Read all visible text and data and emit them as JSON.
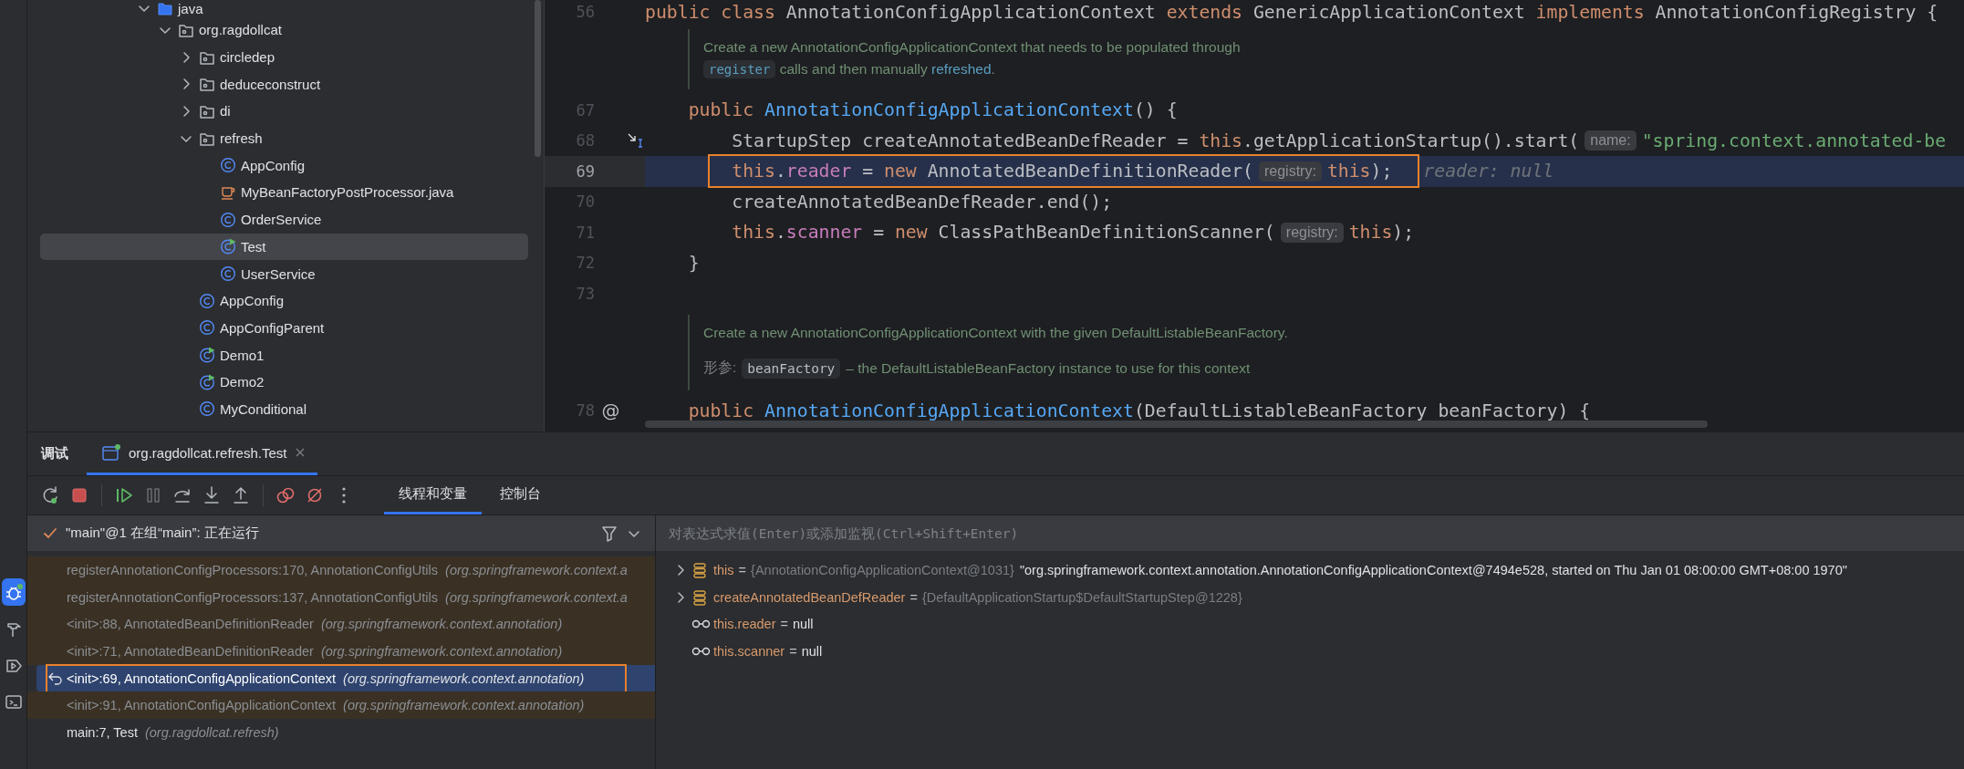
{
  "tool_strip": [
    {
      "kind": "debug",
      "selected": true
    },
    {
      "kind": "build",
      "selected": false
    },
    {
      "kind": "run",
      "selected": false
    },
    {
      "kind": "terminal",
      "selected": false
    }
  ],
  "project_tree": [
    {
      "label": "java",
      "kind": "source-root",
      "expanded": true,
      "selected": false,
      "children": [
        {
          "label": "org.ragdollcat",
          "kind": "package",
          "expanded": true,
          "selected": false,
          "children": [
            {
              "label": "circledep",
              "kind": "package",
              "expanded": false,
              "selected": false
            },
            {
              "label": "deduceconstruct",
              "kind": "package",
              "expanded": false,
              "selected": false
            },
            {
              "label": "di",
              "kind": "package",
              "expanded": false,
              "selected": false
            },
            {
              "label": "refresh",
              "kind": "package",
              "expanded": true,
              "selected": false,
              "children": [
                {
                  "label": "AppConfig",
                  "kind": "class",
                  "selected": false
                },
                {
                  "label": "MyBeanFactoryPostProcessor.java",
                  "kind": "java-file",
                  "selected": false
                },
                {
                  "label": "OrderService",
                  "kind": "class",
                  "selected": false
                },
                {
                  "label": "Test",
                  "kind": "main-class",
                  "selected": true
                },
                {
                  "label": "UserService",
                  "kind": "class",
                  "selected": false
                }
              ]
            },
            {
              "label": "AppConfig",
              "kind": "class",
              "selected": false
            },
            {
              "label": "AppConfigParent",
              "kind": "class",
              "selected": false
            },
            {
              "label": "Demo1",
              "kind": "main-class",
              "selected": false
            },
            {
              "label": "Demo2",
              "kind": "main-class",
              "selected": false
            },
            {
              "label": "MyConditional",
              "kind": "class",
              "selected": false
            }
          ]
        }
      ]
    }
  ],
  "editor": {
    "lines": [
      {
        "kind": "code",
        "number": "56",
        "current": false,
        "tokens": [
          {
            "text": "public class ",
            "kind": "keyword"
          },
          {
            "text": "AnnotationConfigApplicationContext ",
            "kind": "plain"
          },
          {
            "text": "extends ",
            "kind": "keyword"
          },
          {
            "text": "GenericApplicationContext ",
            "kind": "plain"
          },
          {
            "text": "implements ",
            "kind": "keyword"
          },
          {
            "text": "AnnotationConfigRegistry {",
            "kind": "plain"
          }
        ]
      },
      {
        "kind": "doc",
        "paragraphs": [
          {
            "kind": "text",
            "segments": [
              {
                "kind": "text",
                "text": "Create a new AnnotationConfigApplicationContext that needs to be populated through "
              },
              {
                "kind": "code",
                "text": "register"
              },
              {
                "kind": "text",
                "text": " calls and then manually "
              },
              {
                "kind": "link",
                "text": "refreshed"
              },
              {
                "kind": "text",
                "text": "."
              }
            ]
          }
        ]
      },
      {
        "kind": "code",
        "number": "67",
        "current": false,
        "tokens": [
          {
            "text": "    public ",
            "kind": "keyword"
          },
          {
            "text": "AnnotationConfigApplicationContext",
            "kind": "method"
          },
          {
            "text": "() {",
            "kind": "plain"
          }
        ]
      },
      {
        "kind": "code",
        "number": "68",
        "current": false,
        "execution_point": true,
        "tokens": [
          {
            "text": "        StartupStep createAnnotatedBeanDefReader = ",
            "kind": "plain"
          },
          {
            "text": "this",
            "kind": "keyword"
          },
          {
            "text": ".getApplicationStartup().start(",
            "kind": "plain"
          },
          {
            "text": "name:",
            "kind": "hint"
          },
          {
            "text": "\"spring.context.annotated-be",
            "kind": "string"
          }
        ]
      },
      {
        "kind": "code",
        "number": "69",
        "current": true,
        "tokens": [
          {
            "kind": "group",
            "boxed": true,
            "tokens": [
              {
                "text": "        this",
                "kind": "keyword"
              },
              {
                "text": ".",
                "kind": "plain"
              },
              {
                "text": "reader",
                "kind": "field"
              },
              {
                "text": " = ",
                "kind": "plain"
              },
              {
                "text": "new ",
                "kind": "keyword"
              },
              {
                "text": "AnnotatedBeanDefinitionReader(",
                "kind": "plain"
              },
              {
                "text": "registry:",
                "kind": "hint"
              },
              {
                "text": "this",
                "kind": "keyword"
              },
              {
                "text": ");",
                "kind": "plain"
              }
            ]
          },
          {
            "text": "reader: null",
            "kind": "value"
          }
        ]
      },
      {
        "kind": "code",
        "number": "70",
        "current": false,
        "tokens": [
          {
            "text": "        createAnnotatedBeanDefReader.end();",
            "kind": "plain"
          }
        ]
      },
      {
        "kind": "code",
        "number": "71",
        "current": false,
        "tokens": [
          {
            "text": "        this",
            "kind": "keyword"
          },
          {
            "text": ".",
            "kind": "plain"
          },
          {
            "text": "scanner",
            "kind": "field"
          },
          {
            "text": " = ",
            "kind": "plain"
          },
          {
            "text": "new ",
            "kind": "keyword"
          },
          {
            "text": "ClassPathBeanDefinitionScanner(",
            "kind": "plain"
          },
          {
            "text": "registry:",
            "kind": "hint"
          },
          {
            "text": "this",
            "kind": "keyword"
          },
          {
            "text": ");",
            "kind": "plain"
          }
        ]
      },
      {
        "kind": "code",
        "number": "72",
        "current": false,
        "tokens": [
          {
            "text": "    }",
            "kind": "plain"
          }
        ]
      },
      {
        "kind": "code",
        "number": "73",
        "current": false
      },
      {
        "kind": "doc",
        "paragraphs": [
          {
            "kind": "text",
            "segments": [
              {
                "kind": "text",
                "text": "Create a new AnnotationConfigApplicationContext with the given DefaultListableBeanFactory."
              }
            ]
          },
          {
            "kind": "param",
            "label": "形参:",
            "name": "beanFactory",
            "text": "– the DefaultListableBeanFactory instance to use for this context"
          }
        ]
      },
      {
        "kind": "code",
        "number": "78",
        "current": false,
        "gutter_mark": "@",
        "tokens": [
          {
            "text": "    public ",
            "kind": "keyword"
          },
          {
            "text": "AnnotationConfigApplicationContext",
            "kind": "method"
          },
          {
            "text": "(DefaultListableBeanFactory beanFactory) {",
            "kind": "plain"
          }
        ]
      }
    ]
  },
  "debug_panel": {
    "title": "调试",
    "session_tabs": [
      {
        "label": "org.ragdollcat.refresh.Test",
        "selected": true
      }
    ],
    "toolbar": [
      {
        "kind": "rerun",
        "disabled": false
      },
      {
        "kind": "stop",
        "disabled": false
      },
      {
        "kind": "resume",
        "disabled": false
      },
      {
        "kind": "pause",
        "disabled": true
      },
      {
        "kind": "step-over",
        "disabled": false
      },
      {
        "kind": "step-into",
        "disabled": false
      },
      {
        "kind": "step-out",
        "disabled": false
      },
      {
        "kind": "breakpoints",
        "disabled": false
      },
      {
        "kind": "mute-breakpoints",
        "disabled": false
      },
      {
        "kind": "more",
        "disabled": false
      }
    ],
    "view_tabs": [
      {
        "label": "线程和变量",
        "selected": true
      },
      {
        "label": "控制台",
        "selected": false
      }
    ],
    "thread": {
      "label": "\"main\"@1 在组“main”: 正在运行"
    },
    "frames": [
      {
        "method": "registerAnnotationConfigProcessors:170, AnnotationConfigUtils",
        "package": "(org.springframework.context.a",
        "library": true,
        "selected": false,
        "boxed": false
      },
      {
        "method": "registerAnnotationConfigProcessors:137, AnnotationConfigUtils",
        "package": "(org.springframework.context.a",
        "library": true,
        "selected": false,
        "boxed": false
      },
      {
        "method": "<init>:88, AnnotatedBeanDefinitionReader",
        "package": "(org.springframework.context.annotation)",
        "library": true,
        "selected": false,
        "boxed": false
      },
      {
        "method": "<init>:71, AnnotatedBeanDefinitionReader",
        "package": "(org.springframework.context.annotation)",
        "library": true,
        "selected": false,
        "boxed": false
      },
      {
        "method": "<init>:69, AnnotationConfigApplicationContext",
        "package": "(org.springframework.context.annotation)",
        "library": false,
        "selected": true,
        "boxed": true
      },
      {
        "method": "<init>:91, AnnotationConfigApplicationContext",
        "package": "(org.springframework.context.annotation)",
        "library": true,
        "selected": false,
        "boxed": false
      },
      {
        "method": "main:7, Test",
        "package": "(org.ragdollcat.refresh)",
        "library": false,
        "selected": false,
        "boxed": false
      }
    ],
    "expression": {
      "placeholder": "对表达式求值(Enter)或添加监视(Ctrl+Shift+Enter)"
    },
    "variables": [
      {
        "kind": "field",
        "name": "this",
        "sign": "=",
        "type": "{AnnotationConfigApplicationContext@1031}",
        "value": "\"org.springframework.context.annotation.AnnotationConfigApplicationContext@7494e528, started on Thu Jan 01 08:00:00 GMT+08:00 1970\"",
        "expanded": false
      },
      {
        "kind": "field",
        "name": "createAnnotatedBeanDefReader",
        "sign": "=",
        "type": "{DefaultApplicationStartup$DefaultStartupStep@1228}",
        "expanded": false
      },
      {
        "kind": "watch",
        "name": "this.reader",
        "sign": "=",
        "value": "null"
      },
      {
        "kind": "watch",
        "name": "this.scanner",
        "sign": "=",
        "value": "null"
      }
    ]
  }
}
